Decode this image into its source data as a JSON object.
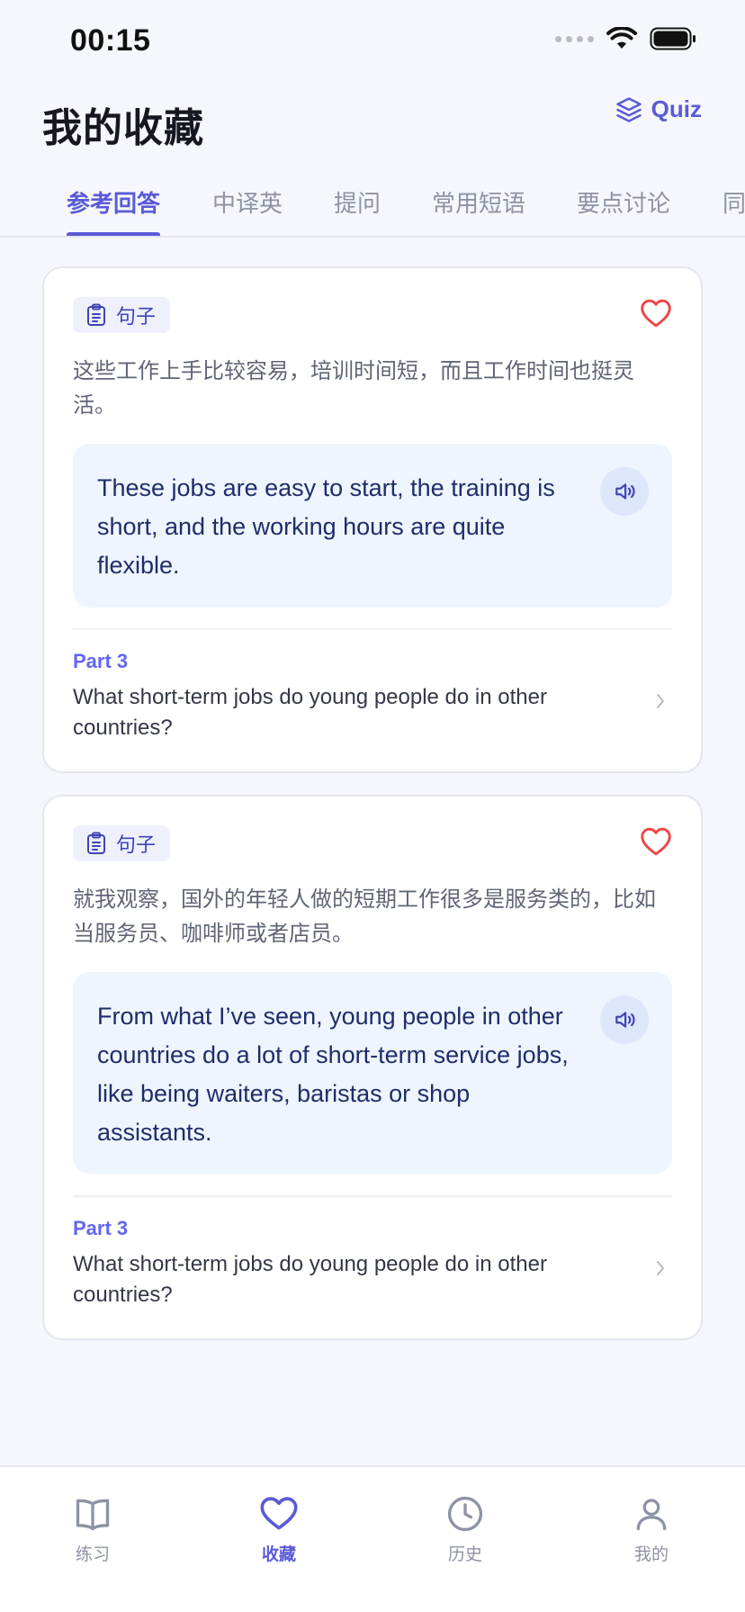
{
  "status_bar": {
    "time": "00:15"
  },
  "header": {
    "title": "我的收藏",
    "quiz_label": "Quiz"
  },
  "tabs": [
    {
      "label": "参考回答",
      "active": true
    },
    {
      "label": "中译英"
    },
    {
      "label": "提问"
    },
    {
      "label": "常用短语"
    },
    {
      "label": "要点讨论"
    },
    {
      "label": "同"
    }
  ],
  "cards": [
    {
      "tag": "句子",
      "zh": "这些工作上手比较容易，培训时间短，而且工作时间也挺灵活。",
      "en": "These jobs are easy to start, the training is short, and the working hours are quite flexible.",
      "part": "Part 3",
      "question": "What short-term jobs do young people do in other countries?"
    },
    {
      "tag": "句子",
      "zh": "就我观察，国外的年轻人做的短期工作很多是服务类的，比如当服务员、咖啡师或者店员。",
      "en": "From what I’ve seen, young people in other countries do a lot of short-term service jobs, like being waiters, baristas or shop assistants.",
      "part": "Part 3",
      "question": "What short-term jobs do young people do in other countries?"
    }
  ],
  "bottom_nav": [
    {
      "label": "练习",
      "icon": "book-icon"
    },
    {
      "label": "收藏",
      "icon": "heart-icon",
      "active": true
    },
    {
      "label": "历史",
      "icon": "clock-icon"
    },
    {
      "label": "我的",
      "icon": "user-icon"
    }
  ],
  "colors": {
    "accent": "#5b5bd6",
    "favorite": "#ef4444",
    "sentence_bg": "#eef5fe",
    "page_bg": "#f5f7fc"
  }
}
